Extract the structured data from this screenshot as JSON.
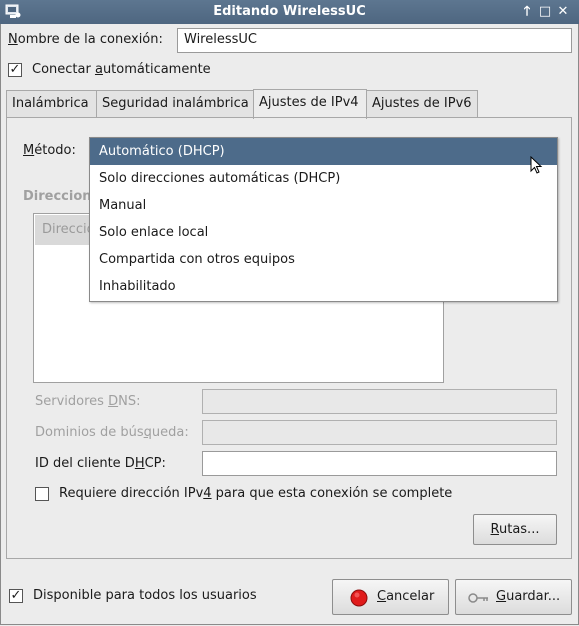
{
  "window": {
    "title": "Editando WirelessUC",
    "buttons": {
      "up": "🡑",
      "maximize": "□",
      "close": "✕"
    }
  },
  "connection_name": {
    "label_pre": "",
    "label_mnemonic": "N",
    "label_post": "ombre de la conexión:",
    "value": "WirelessUC"
  },
  "autoconnect": {
    "label_pre": "Conectar ",
    "label_mnemonic": "a",
    "label_post": "utomáticamente",
    "checked": "✓"
  },
  "tabs": [
    "Inalámbrica",
    "Seguridad inalámbrica",
    "Ajustes de IPv4",
    "Ajustes de IPv6"
  ],
  "ipv4": {
    "method_label_pre": "",
    "method_label_mnemonic": "M",
    "method_label_post": "étodo:",
    "method_options": [
      "Automático (DHCP)",
      "Solo direcciones automáticas (DHCP)",
      "Manual",
      "Solo enlace local",
      "Compartida con otros equipos",
      "Inhabilitado"
    ],
    "addresses_label": "Direcciones",
    "addresses_col": "Dirección",
    "dns_pre": "Servidores ",
    "dns_mnemonic": "D",
    "dns_post": "NS:",
    "search_pre": "Dominios de bús",
    "search_mnemonic": "q",
    "search_post": "ueda:",
    "dhcp_pre": "ID del cliente D",
    "dhcp_mnemonic": "H",
    "dhcp_post": "CP:",
    "require_pre": "Requiere dirección IPv",
    "require_mnemonic": "4",
    "require_post": " para que esta conexión se complete",
    "routes_pre": "",
    "routes_mnemonic": "R",
    "routes_post": "utas..."
  },
  "footer": {
    "all_users": "Disponible para todos los usuarios",
    "all_users_checked": "✓",
    "cancel_pre": "",
    "cancel_mnemonic": "C",
    "cancel_post": "ancelar",
    "save_pre": "",
    "save_mnemonic": "G",
    "save_post": "uardar..."
  },
  "colors": {
    "titlebar": "#4e6680",
    "selection": "#4d6b8a",
    "cancel_icon": "#e01b1b"
  }
}
